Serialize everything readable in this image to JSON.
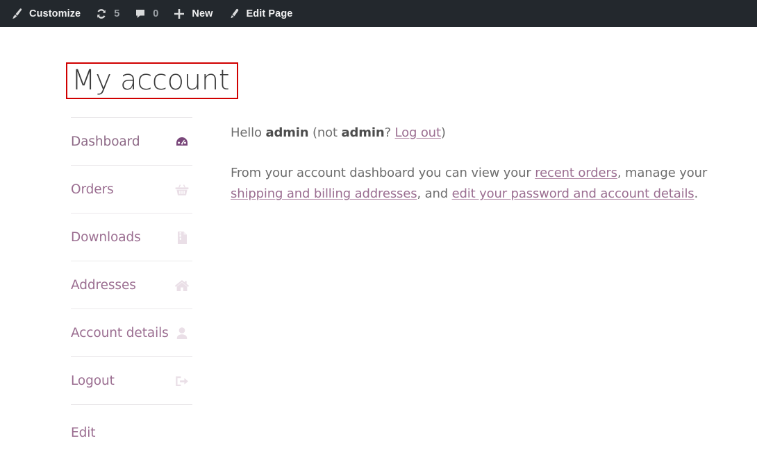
{
  "admin_bar": {
    "background": "#23282d",
    "items": [
      {
        "name": "customize",
        "icon": "paintbrush-icon",
        "label": "Customize",
        "count": null
      },
      {
        "name": "updates",
        "icon": "refresh-icon",
        "label": null,
        "count": "5"
      },
      {
        "name": "comments",
        "icon": "comment-bubble-icon",
        "label": null,
        "count": "0"
      },
      {
        "name": "new",
        "icon": "plus-icon",
        "label": "New",
        "count": null
      },
      {
        "name": "edit-page",
        "icon": "pencil-icon",
        "label": "Edit Page",
        "count": null
      }
    ]
  },
  "page": {
    "title": "My account",
    "title_highlight_color": "#d00000"
  },
  "account_nav": {
    "accent_color": "#9b6e91",
    "active_icon_color": "#79477a",
    "inactive_icon_color": "#eadfe7",
    "items": [
      {
        "label": "Dashboard",
        "icon": "dashboard-gauge-icon",
        "active": true
      },
      {
        "label": "Orders",
        "icon": "shopping-basket-icon",
        "active": false
      },
      {
        "label": "Downloads",
        "icon": "file-archive-icon",
        "active": false
      },
      {
        "label": "Addresses",
        "icon": "home-icon",
        "active": false
      },
      {
        "label": "Account details",
        "icon": "user-icon",
        "active": false
      },
      {
        "label": "Logout",
        "icon": "sign-out-icon",
        "active": false
      }
    ],
    "edit_label": "Edit"
  },
  "content": {
    "greeting": {
      "hello": "Hello ",
      "username": "admin",
      "not_prefix": " (not ",
      "not_username": "admin",
      "question": "? ",
      "logout_link": "Log out",
      "close": ")"
    },
    "intro": {
      "part1": "From your account dashboard you can view your ",
      "link_recent_orders": "recent orders",
      "part2": ", manage your ",
      "link_addresses": "shipping and billing addresses",
      "part3": ", and ",
      "link_account_details": "edit your password and account details",
      "part4": "."
    }
  }
}
